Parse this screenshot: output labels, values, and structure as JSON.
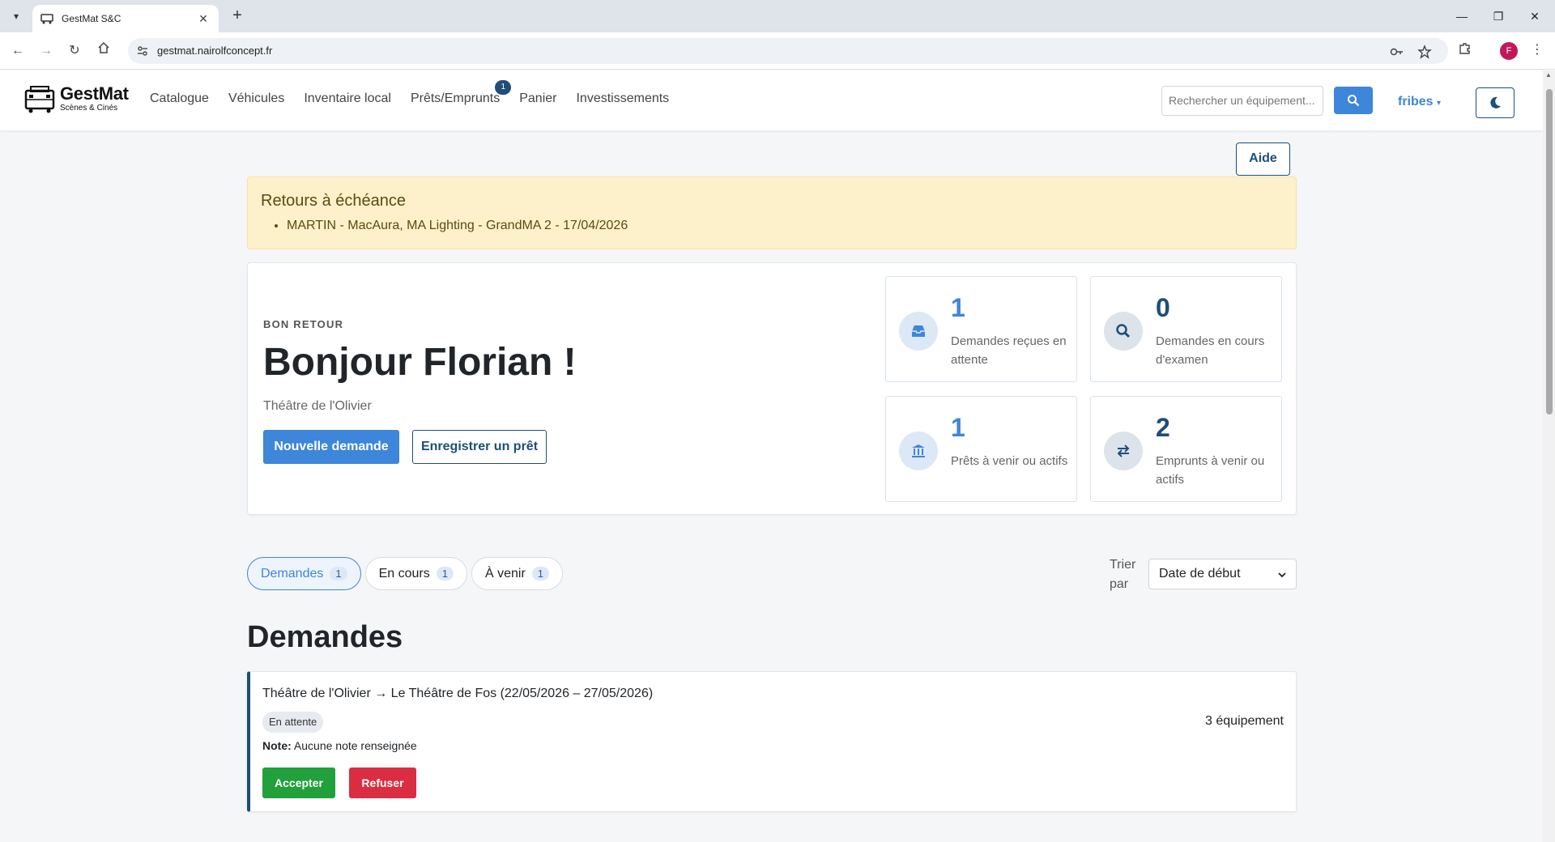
{
  "browser": {
    "tab_title": "GestMat S&C",
    "url": "gestmat.nairolfconcept.fr",
    "profile_initial": "F"
  },
  "navbar": {
    "logo_title": "GestMat",
    "logo_sub": "Scènes & Cinés",
    "links": [
      "Catalogue",
      "Véhicules",
      "Inventaire local",
      "Prêts/Emprunts",
      "Panier",
      "Investissements"
    ],
    "loans_badge": "1",
    "search_placeholder": "Rechercher un équipement...",
    "user": "fribes"
  },
  "help_button": "Aide",
  "alert": {
    "title": "Retours à échéance",
    "items": [
      "MARTIN - MacAura, MA Lighting - GrandMA 2 - 17/04/2026"
    ]
  },
  "welcome": {
    "kicker": "BON RETOUR",
    "title": "Bonjour Florian !",
    "organization": "Théâtre de l'Olivier",
    "new_request": "Nouvelle demande",
    "register_loan": "Enregistrer un prêt"
  },
  "stats": [
    {
      "value": "1",
      "label": "Demandes reçues en attente",
      "icon": "inbox-icon",
      "color": "#3d86d9"
    },
    {
      "value": "0",
      "label": "Demandes en cours d'examen",
      "icon": "search-icon",
      "color": "#1f4e79"
    },
    {
      "value": "1",
      "label": "Prêts à venir ou actifs",
      "icon": "bank-icon",
      "color": "#3d86d9"
    },
    {
      "value": "2",
      "label": "Emprunts à venir ou actifs",
      "icon": "exchange-icon",
      "color": "#1f4e79"
    }
  ],
  "tabs": [
    {
      "label": "Demandes",
      "count": "1"
    },
    {
      "label": "En cours",
      "count": "1"
    },
    {
      "label": "À venir",
      "count": "1"
    }
  ],
  "sort": {
    "label": "Trier par",
    "selected": "Date de début"
  },
  "section_title": "Demandes",
  "request": {
    "route": "Théâtre de l'Olivier → Le Théâtre de Fos (22/05/2026 – 27/05/2026)",
    "status": "En attente",
    "equipment_count": "3 équipement",
    "note_label": "Note:",
    "note_value": "Aucune note renseignée",
    "accept": "Accepter",
    "refuse": "Refuser"
  }
}
